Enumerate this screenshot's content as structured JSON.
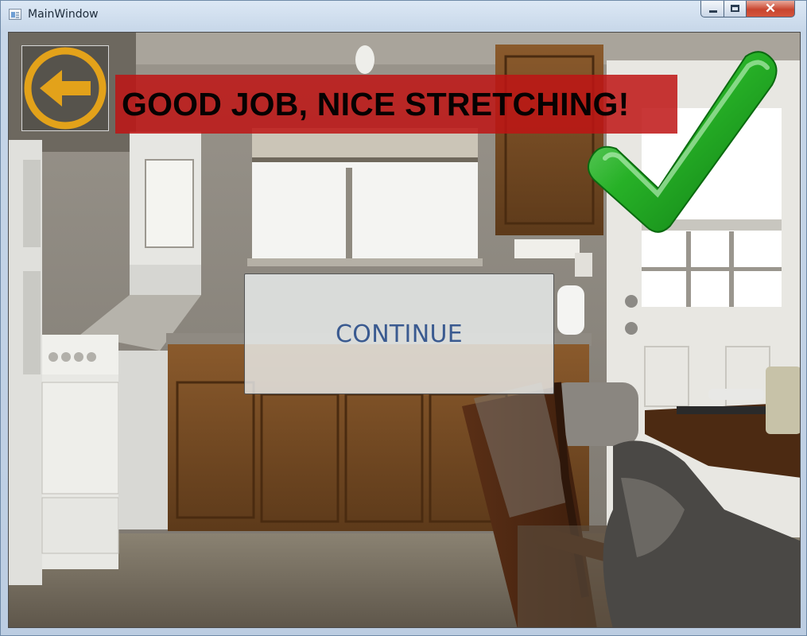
{
  "window": {
    "title": "MainWindow",
    "controls": {
      "minimize": "minimize",
      "maximize": "maximize",
      "close": "✕"
    }
  },
  "overlay": {
    "back_icon": "arrow-left-icon",
    "banner_text": "GOOD JOB, NICE STRETCHING!",
    "checkmark_icon": "checkmark-icon",
    "continue_label": "CONTINUE"
  },
  "colors": {
    "banner": "#be1414",
    "back_ring": "#e3a21a",
    "check": "#2bb52b",
    "continue_text": "#3a5a90"
  }
}
